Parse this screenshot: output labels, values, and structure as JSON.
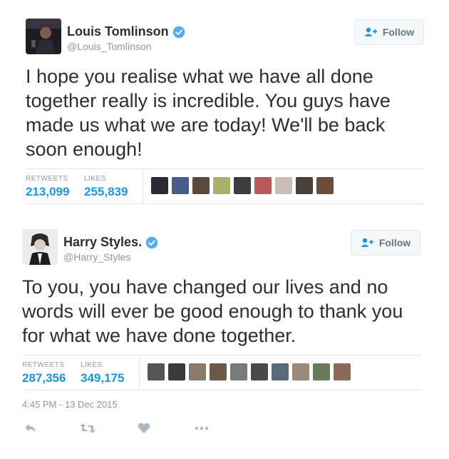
{
  "tweets": [
    {
      "name": "Louis Tomlinson",
      "handle": "@Louis_Tomlinson",
      "follow_label": "Follow",
      "text": "I hope you realise what we have all done together really is incredible. You guys have made us what we are today! We'll be back soon enough!",
      "retweets_label": "RETWEETS",
      "retweets": "213,099",
      "likes_label": "LIKES",
      "likes": "255,839",
      "liker_colors": [
        "#2d2a36",
        "#4a5a8a",
        "#5d4a3d",
        "#a8b06a",
        "#3b3b3b",
        "#b85a5a",
        "#c9bfb8",
        "#4a3f35",
        "#6b4d3b"
      ]
    },
    {
      "name": "Harry Styles.",
      "handle": "@Harry_Styles",
      "follow_label": "Follow",
      "text": "To you, you have changed our lives and no words will ever be good enough to thank you for what we have done together.",
      "retweets_label": "RETWEETS",
      "retweets": "287,356",
      "likes_label": "LIKES",
      "likes": "349,175",
      "liker_colors": [
        "#555555",
        "#3a3a3a",
        "#8a7a6a",
        "#6a5a4a",
        "#7a7a7a",
        "#4a4a4a",
        "#5a6a7a",
        "#9a8a7a",
        "#6a7a5a",
        "#8a6a5a"
      ]
    }
  ],
  "timestamp": "4:45 PM - 13 Dec 2015",
  "actions": [
    "reply-icon",
    "retweet-icon",
    "like-icon",
    "more-icon"
  ],
  "colors": {
    "accent": "#1b95e0",
    "verified": "#55acee",
    "muted": "#8899a6"
  }
}
